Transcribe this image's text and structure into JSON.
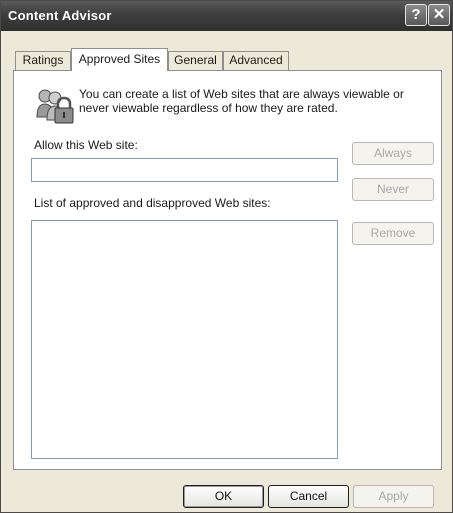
{
  "window": {
    "title": "Content Advisor",
    "help_glyph": "?",
    "close_glyph": "✕"
  },
  "tabs": [
    {
      "label": "Ratings",
      "active": false
    },
    {
      "label": "Approved Sites",
      "active": true
    },
    {
      "label": "General",
      "active": false
    },
    {
      "label": "Advanced",
      "active": false
    }
  ],
  "panel": {
    "icon": "people-lock-icon",
    "info_text": "You can create a list of Web sites that are always viewable or never viewable regardless of how they are rated.",
    "allow_label": "Allow this Web site:",
    "site_input_value": "",
    "list_label": "List of approved and disapproved Web sites:",
    "sites": [],
    "buttons": {
      "always": "Always",
      "never": "Never",
      "remove": "Remove"
    }
  },
  "footer": {
    "ok": "OK",
    "cancel": "Cancel",
    "apply": "Apply"
  }
}
